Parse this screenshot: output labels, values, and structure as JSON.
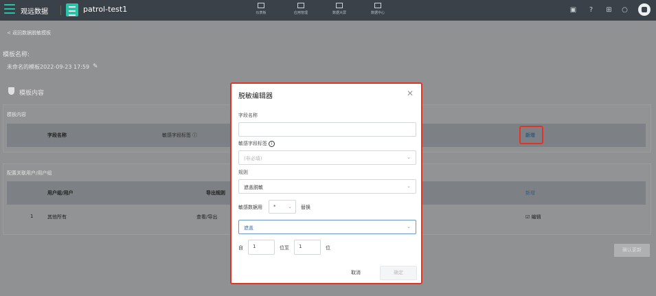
{
  "topbar": {
    "brand": "观远数据",
    "app_name": "patrol-test1",
    "nav": [
      "仪表板",
      "应用管理",
      "数据大屏",
      "数据中心"
    ],
    "accent": "#27c4a8"
  },
  "page": {
    "back_link": "< 返回数据脱敏模板",
    "template_label": "模板名称:",
    "template_name": "未命名的模板2022-09-23 17:59",
    "section_title": "模板内容",
    "confirm_save": "确认更新"
  },
  "content_panel": {
    "title": "模板内容",
    "headers": {
      "field_name": "字段名称",
      "sensitive_tag": "敏感字段标签",
      "add": "新增"
    }
  },
  "users_panel": {
    "title": "配置关联用户/用户组",
    "headers": {
      "user": "用户组/用户",
      "export_rule": "导出规则",
      "add": "新增"
    },
    "rows": [
      {
        "index": "1",
        "user": "其他所有",
        "export_rule": "查看/导出",
        "edit": "编辑"
      }
    ]
  },
  "modal": {
    "title": "脱敏编辑器",
    "field_name_label": "字段名称",
    "field_name_value": "",
    "tag_label": "敏感字段标签",
    "tag_placeholder": "(非必填)",
    "rule_label": "规则",
    "rule_value": "遮盖脱敏",
    "replace_prefix": "敏感数据用",
    "replace_char": "*",
    "replace_suffix": "替换",
    "mode_value": "遮盖",
    "from_label": "自",
    "from_value": "1",
    "to_label": "位至",
    "to_value": "1",
    "unit_label": "位",
    "cancel": "取消",
    "ok": "确定"
  }
}
